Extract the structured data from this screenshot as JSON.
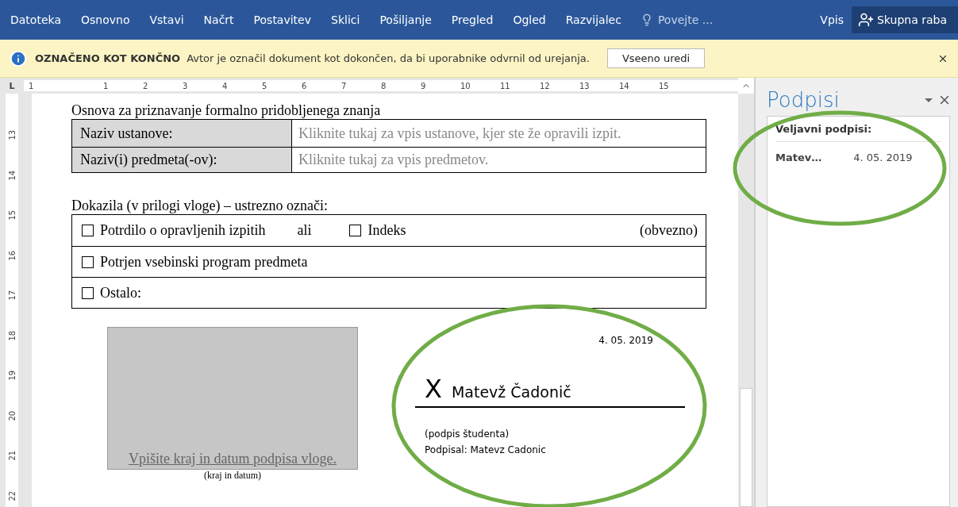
{
  "ribbon": {
    "tabs": [
      {
        "label": "Datoteka",
        "selected": false
      },
      {
        "label": "Osnovno",
        "selected": false
      },
      {
        "label": "Vstavi",
        "selected": false
      },
      {
        "label": "Načrt",
        "selected": false
      },
      {
        "label": "Postavitev",
        "selected": false
      },
      {
        "label": "Sklici",
        "selected": false
      },
      {
        "label": "Pošiljanje",
        "selected": false
      },
      {
        "label": "Pregled",
        "selected": false
      },
      {
        "label": "Ogled",
        "selected": false
      },
      {
        "label": "Razvijalec",
        "selected": false
      }
    ],
    "tell_me": {
      "placeholder": "Povejte ..."
    },
    "sign_in": "Vpis",
    "share": "Skupna raba"
  },
  "message_bar": {
    "title": "OZNAČENO KOT KONČNO",
    "text": "Avtor je označil dokument kot dokončen, da bi uporabnike odvrnil od urejanja.",
    "button": "Vseeno uredi"
  },
  "ruler": {
    "tab_selector": "L",
    "horizontal": [
      "1",
      "1",
      "2",
      "3",
      "4",
      "5",
      "6",
      "7",
      "8",
      "9",
      "10",
      "11",
      "12",
      "13",
      "14",
      "15"
    ],
    "vertical": [
      "13",
      "14",
      "15",
      "16",
      "17",
      "18",
      "19",
      "20",
      "21",
      "22"
    ]
  },
  "document": {
    "heading": "Osnova za priznavanje formalno pridobljenega znanja",
    "info_table": [
      {
        "label": "Naziv ustanove:",
        "placeholder": "Kliknite tukaj za vpis ustanove, kjer ste že opravili izpit."
      },
      {
        "label": "Naziv(i) predmeta(-ov):",
        "placeholder": "Kliknite tukaj za vpis predmetov."
      }
    ],
    "evidence_heading": "Dokazila (v prilogi vloge) – ustrezno označi:",
    "evidence_rows": [
      {
        "items": [
          {
            "kind": "checkbox",
            "label": "Potrdilo o opravljenih izpitih",
            "checked": false
          },
          {
            "kind": "text",
            "label": "ali"
          },
          {
            "kind": "checkbox",
            "label": "Indeks",
            "checked": false
          },
          {
            "kind": "note",
            "label": "(obvezno)"
          }
        ]
      },
      {
        "items": [
          {
            "kind": "checkbox",
            "label": "Potrjen vsebinski program predmeta",
            "checked": false
          }
        ]
      },
      {
        "items": [
          {
            "kind": "checkbox",
            "label": "Ostalo:",
            "checked": false
          }
        ]
      }
    ],
    "place_date": {
      "placeholder": "Vpišite kraj in datum podpisa vloge.",
      "caption": "(kraj in datum)"
    },
    "signature": {
      "date": "4. 05. 2019",
      "mark": "X",
      "name": "Matevž Čadonič",
      "role": "(podpis študenta)",
      "signed_by": "Podpisal: Matevz Cadonic"
    }
  },
  "signatures_pane": {
    "title": "Podpisi",
    "section": "Veljavni podpisi:",
    "items": [
      {
        "signer": "Matev…",
        "date": "4. 05. 2019"
      }
    ]
  }
}
